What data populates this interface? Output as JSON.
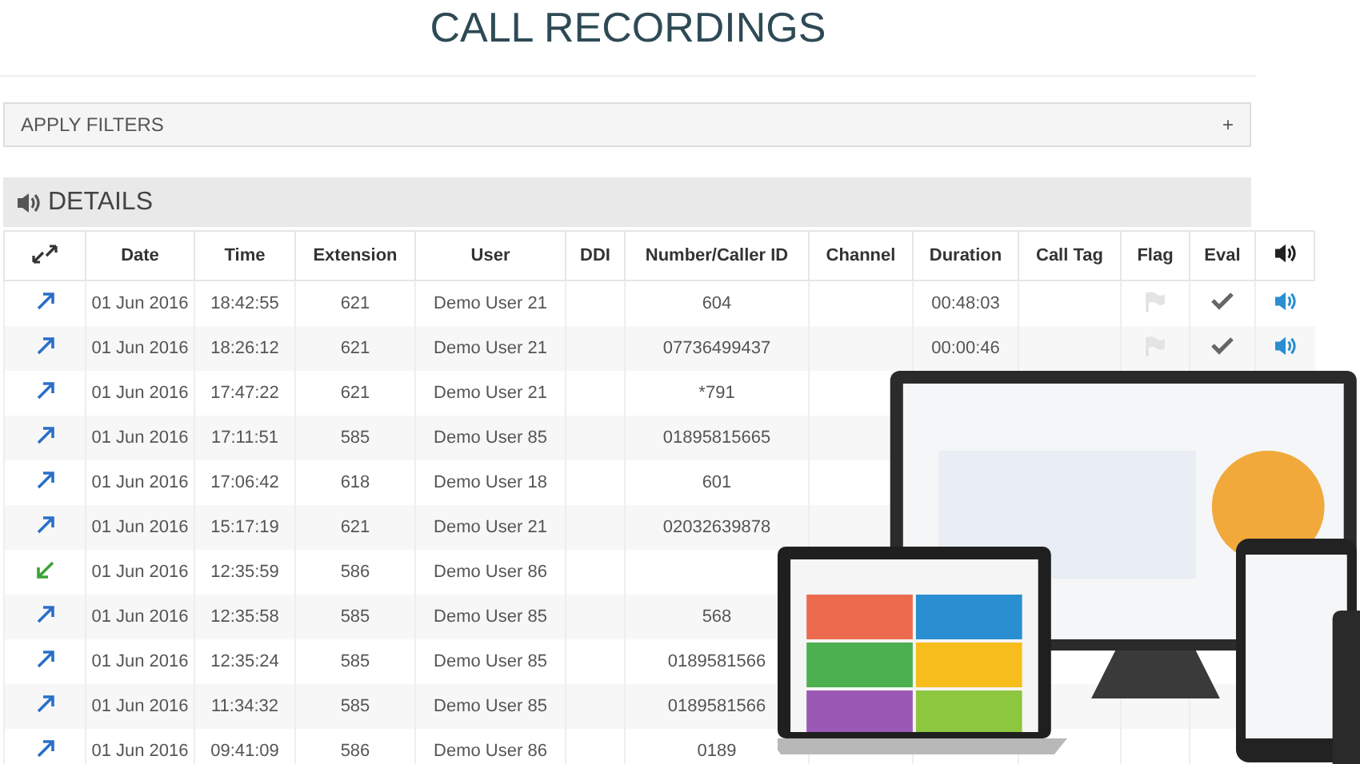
{
  "title": "CALL RECORDINGS",
  "filters": {
    "label": "APPLY FILTERS",
    "toggle": "+"
  },
  "details": {
    "title": "DETAILS"
  },
  "table": {
    "columns": [
      {
        "kind": "direction"
      },
      {
        "kind": "text",
        "label": "Date"
      },
      {
        "kind": "text",
        "label": "Time"
      },
      {
        "kind": "text",
        "label": "Extension"
      },
      {
        "kind": "text",
        "label": "User"
      },
      {
        "kind": "text",
        "label": "DDI"
      },
      {
        "kind": "text",
        "label": "Number/Caller ID"
      },
      {
        "kind": "text",
        "label": "Channel"
      },
      {
        "kind": "text",
        "label": "Duration"
      },
      {
        "kind": "text",
        "label": "Call Tag"
      },
      {
        "kind": "text",
        "label": "Flag"
      },
      {
        "kind": "text",
        "label": "Eval"
      },
      {
        "kind": "audio"
      }
    ],
    "rows": [
      {
        "incoming": false,
        "date": "01 Jun 2016",
        "time": "18:42:55",
        "extension": "621",
        "user": "Demo User 21",
        "number": "604",
        "duration": "00:48:03",
        "flagged": false,
        "evaluated": true,
        "recording": true
      },
      {
        "incoming": false,
        "date": "01 Jun 2016",
        "time": "18:26:12",
        "extension": "621",
        "user": "Demo User 21",
        "number": "07736499437",
        "duration": "00:00:46",
        "flagged": false,
        "evaluated": true,
        "recording": true
      },
      {
        "incoming": false,
        "date": "01 Jun 2016",
        "time": "17:47:22",
        "extension": "621",
        "user": "Demo User 21",
        "number": "*791"
      },
      {
        "incoming": false,
        "date": "01 Jun 2016",
        "time": "17:11:51",
        "extension": "585",
        "user": "Demo User 85",
        "number": "01895815665"
      },
      {
        "incoming": false,
        "date": "01 Jun 2016",
        "time": "17:06:42",
        "extension": "618",
        "user": "Demo User 18",
        "number": "601"
      },
      {
        "incoming": false,
        "date": "01 Jun 2016",
        "time": "15:17:19",
        "extension": "621",
        "user": "Demo User 21",
        "number": "02032639878"
      },
      {
        "incoming": true,
        "date": "01 Jun 2016",
        "time": "12:35:59",
        "extension": "586",
        "user": "Demo User 86"
      },
      {
        "incoming": false,
        "date": "01 Jun 2016",
        "time": "12:35:58",
        "extension": "585",
        "user": "Demo User 85",
        "number": "568"
      },
      {
        "incoming": false,
        "date": "01 Jun 2016",
        "time": "12:35:24",
        "extension": "585",
        "user": "Demo User 85",
        "number": "0189581566"
      },
      {
        "incoming": false,
        "date": "01 Jun 2016",
        "time": "11:34:32",
        "extension": "585",
        "user": "Demo User 85",
        "number": "0189581566"
      },
      {
        "incoming": false,
        "date": "01 Jun 2016",
        "time": "09:41:09",
        "extension": "586",
        "user": "Demo User 86",
        "number": "0189"
      }
    ]
  }
}
